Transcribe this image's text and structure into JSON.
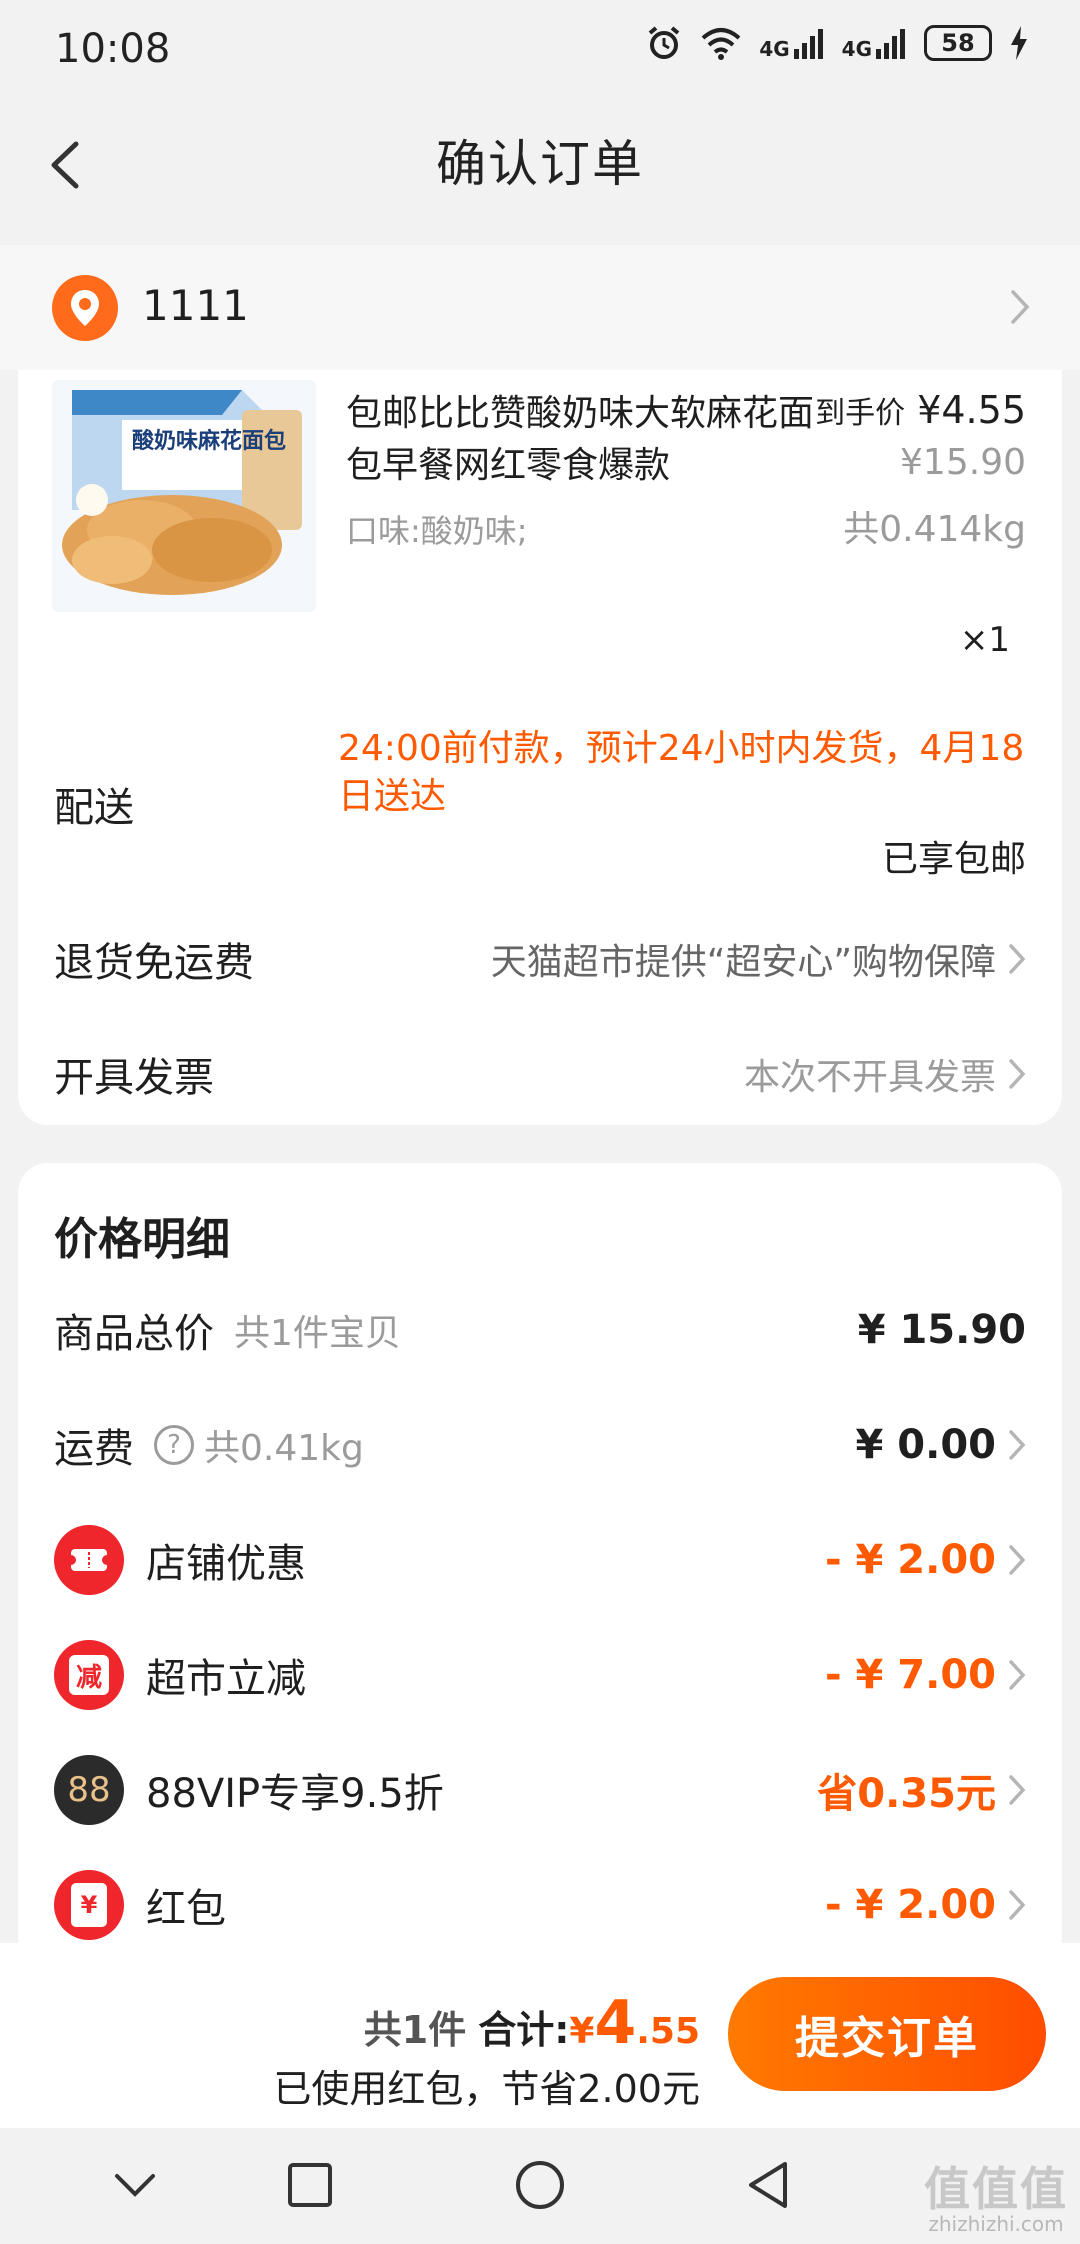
{
  "status_bar": {
    "time": "10:08",
    "network_1": "4G",
    "network_2": "4G",
    "battery": "58"
  },
  "header": {
    "title": "确认订单"
  },
  "address": {
    "text": "1111"
  },
  "product": {
    "name": "包邮比比赞酸奶味大软麻花面包早餐网红零食爆款",
    "final_price_label": "到手价",
    "final_price": "¥4.55",
    "original_price": "¥15.90",
    "variant": "口味:酸奶味;",
    "weight": "共0.414kg",
    "quantity": "×1",
    "image_text": "酸奶味麻花面包"
  },
  "shipping": {
    "label": "配送",
    "note": "24:00前付款，预计24小时内发货，4月18日送达",
    "free_shipping": "已享包邮"
  },
  "return_row": {
    "label": "退货免运费",
    "value": "天猫超市提供“超安心”购物保障"
  },
  "invoice_row": {
    "label": "开具发票",
    "value": "本次不开具发票"
  },
  "price_details": {
    "title": "价格明细",
    "goods_total": {
      "label": "商品总价",
      "sub": "共1件宝贝",
      "amount": "¥ 15.90"
    },
    "freight": {
      "label": "运费",
      "sub": "共0.41kg",
      "amount": "¥ 0.00"
    },
    "store_discount": {
      "label": "店铺优惠",
      "amount": "- ¥ 2.00"
    },
    "market_discount": {
      "label": "超市立减",
      "amount": "- ¥ 7.00",
      "icon_text": "减"
    },
    "vip_discount": {
      "label": "88VIP专享9.5折",
      "amount": "省0.35元",
      "icon_text": "88"
    },
    "red_packet": {
      "label": "红包",
      "amount": "- ¥ 2.00",
      "icon_text": "¥"
    }
  },
  "bottom_bar": {
    "count": "共1件",
    "total_label": "合计:",
    "currency": "¥",
    "total_int": "4",
    "total_dec": ".55",
    "saved": "已使用红包，节省2.00元",
    "submit": "提交订单"
  },
  "watermark": {
    "big": "值值值",
    "small": "zhizhizhi.com"
  },
  "colors": {
    "accent": "#ff5a00",
    "address_icon": "#ff6b1a",
    "discount_icon": "#f0262d"
  }
}
